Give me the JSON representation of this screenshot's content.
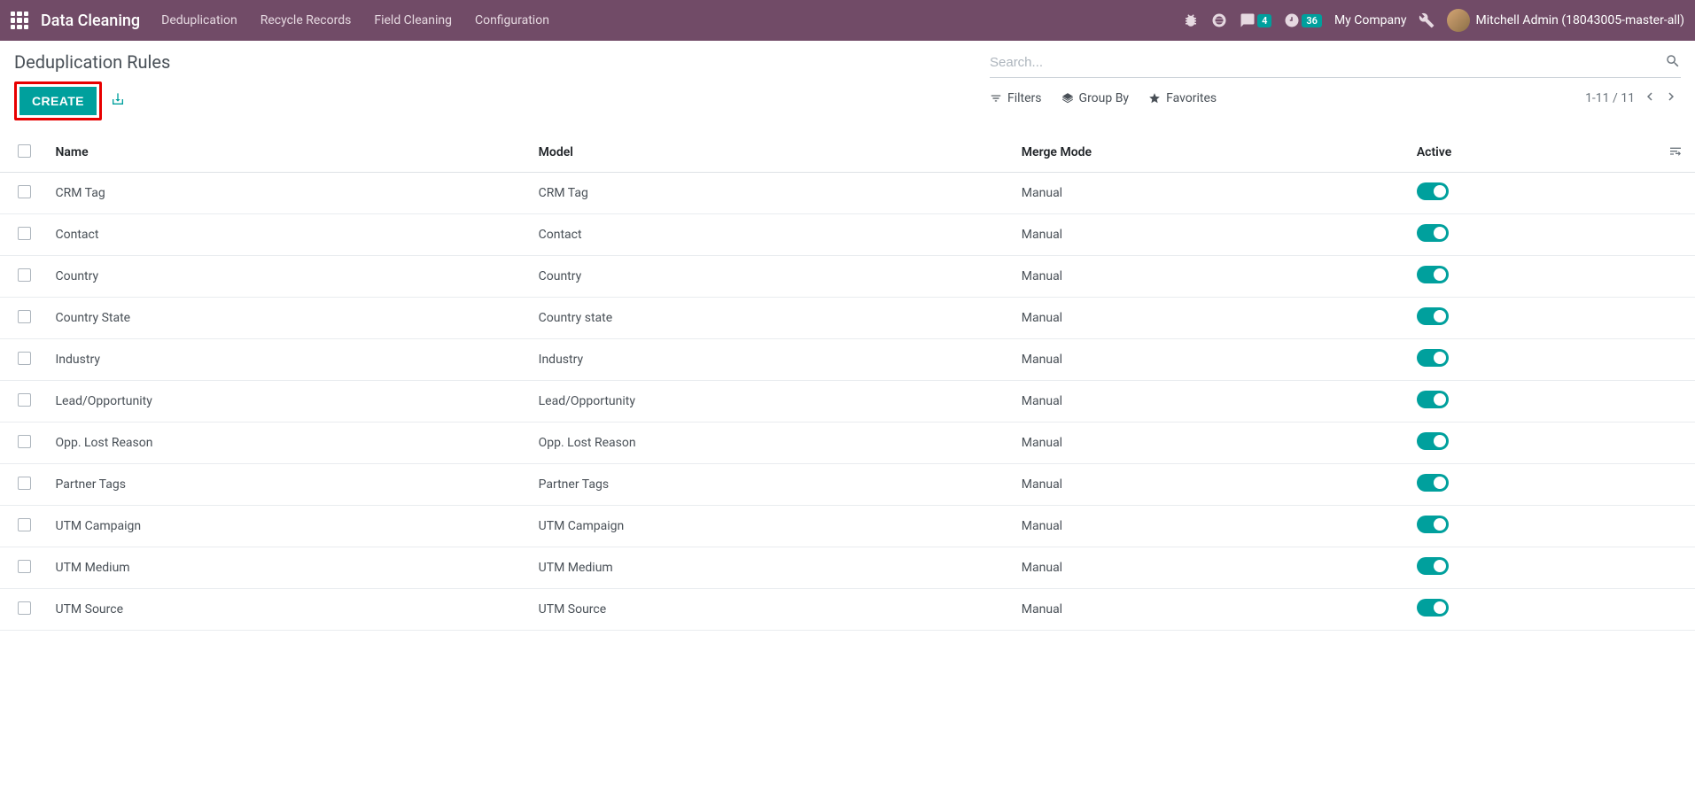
{
  "topnav": {
    "brand": "Data Cleaning",
    "items": [
      "Deduplication",
      "Recycle Records",
      "Field Cleaning",
      "Configuration"
    ],
    "messages_badge": "4",
    "activities_badge": "36",
    "company": "My Company",
    "user": "Mitchell Admin (18043005-master-all)"
  },
  "page": {
    "title": "Deduplication Rules",
    "create_label": "CREATE"
  },
  "search": {
    "placeholder": "Search...",
    "filters_label": "Filters",
    "groupby_label": "Group By",
    "favorites_label": "Favorites",
    "pager_text": "1-11 / 11"
  },
  "columns": {
    "name": "Name",
    "model": "Model",
    "merge_mode": "Merge Mode",
    "active": "Active"
  },
  "rows": [
    {
      "name": "CRM Tag",
      "model": "CRM Tag",
      "merge_mode": "Manual",
      "active": true
    },
    {
      "name": "Contact",
      "model": "Contact",
      "merge_mode": "Manual",
      "active": true
    },
    {
      "name": "Country",
      "model": "Country",
      "merge_mode": "Manual",
      "active": true
    },
    {
      "name": "Country State",
      "model": "Country state",
      "merge_mode": "Manual",
      "active": true
    },
    {
      "name": "Industry",
      "model": "Industry",
      "merge_mode": "Manual",
      "active": true
    },
    {
      "name": "Lead/Opportunity",
      "model": "Lead/Opportunity",
      "merge_mode": "Manual",
      "active": true
    },
    {
      "name": "Opp. Lost Reason",
      "model": "Opp. Lost Reason",
      "merge_mode": "Manual",
      "active": true
    },
    {
      "name": "Partner Tags",
      "model": "Partner Tags",
      "merge_mode": "Manual",
      "active": true
    },
    {
      "name": "UTM Campaign",
      "model": "UTM Campaign",
      "merge_mode": "Manual",
      "active": true
    },
    {
      "name": "UTM Medium",
      "model": "UTM Medium",
      "merge_mode": "Manual",
      "active": true
    },
    {
      "name": "UTM Source",
      "model": "UTM Source",
      "merge_mode": "Manual",
      "active": true
    }
  ]
}
